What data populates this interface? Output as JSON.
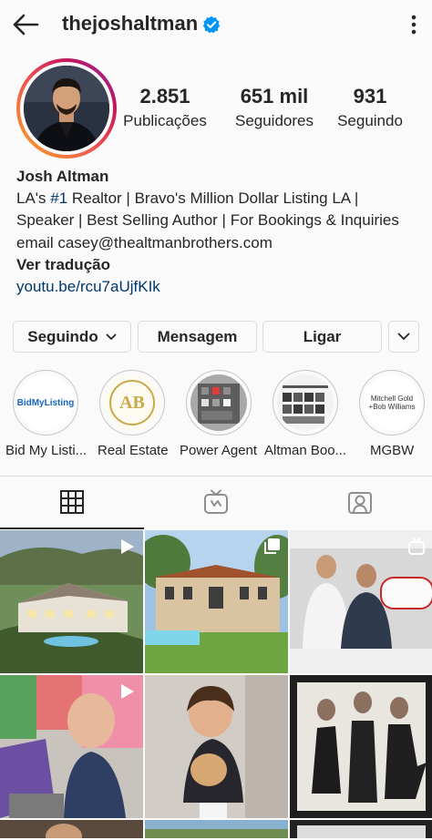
{
  "header": {
    "username": "thejoshaltman"
  },
  "stats": [
    {
      "value": "2.851",
      "label": "Publicações"
    },
    {
      "value": "651 mil",
      "label": "Seguidores"
    },
    {
      "value": "931",
      "label": "Seguindo"
    }
  ],
  "bio": {
    "name": "Josh Altman",
    "line1_prefix": "LA's ",
    "line1_tag": "#1",
    "line1_suffix": " Realtor | Bravo's Million Dollar Listing LA |",
    "line2": "Speaker | Best Selling Author | For Bookings & Inquiries",
    "line3": "email casey@thealtmanbrothers.com",
    "see_translation": "Ver tradução",
    "link": "youtu.be/rcu7aUjfKIk"
  },
  "actions": {
    "following": "Seguindo",
    "message": "Mensagem",
    "call": "Ligar"
  },
  "highlights": [
    {
      "label": "Bid My Listi...",
      "logo": "BidMyListing"
    },
    {
      "label": "Real Estate",
      "logo": "AB"
    },
    {
      "label": "Power Agent"
    },
    {
      "label": "Altman Boo..."
    },
    {
      "label": "MGBW",
      "logo_line1": "Mitchell Gold",
      "logo_line2": "+Bob Williams"
    }
  ],
  "colors": {
    "accent_link": "#00376b",
    "verified": "#0095f6",
    "text": "#262626",
    "border": "#dbdbdb"
  }
}
